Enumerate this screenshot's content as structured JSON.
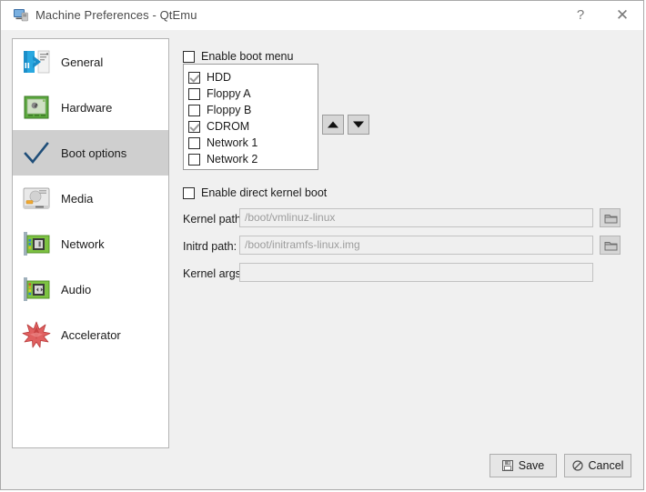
{
  "window": {
    "title": "Machine Preferences - QtEmu",
    "icon": "computer-icon",
    "help_label": "?",
    "close_label": "✕",
    "background": "#f0f0f0"
  },
  "sidebar": {
    "items": [
      {
        "label": "General",
        "icon": "general-icon",
        "selected": false
      },
      {
        "label": "Hardware",
        "icon": "hardware-icon",
        "selected": false
      },
      {
        "label": "Boot options",
        "icon": "boot-options-icon",
        "selected": true
      },
      {
        "label": "Media",
        "icon": "media-icon",
        "selected": false
      },
      {
        "label": "Network",
        "icon": "network-icon",
        "selected": false
      },
      {
        "label": "Audio",
        "icon": "audio-icon",
        "selected": false
      },
      {
        "label": "Accelerator",
        "icon": "accelerator-icon",
        "selected": false
      }
    ],
    "selected_background": "#cfcfcf"
  },
  "boot": {
    "enable_boot_menu_label": "Enable boot menu",
    "enable_boot_menu_checked": false,
    "devices": [
      {
        "label": "HDD",
        "checked": true
      },
      {
        "label": "Floppy A",
        "checked": false
      },
      {
        "label": "Floppy B",
        "checked": false
      },
      {
        "label": "CDROM",
        "checked": true
      },
      {
        "label": "Network 1",
        "checked": false
      },
      {
        "label": "Network 2",
        "checked": false
      }
    ],
    "move_up_icon": "arrow-up-icon",
    "move_down_icon": "arrow-down-icon"
  },
  "kernel": {
    "enable_direct_kernel_boot_label": "Enable direct kernel boot",
    "enable_direct_kernel_boot_checked": false,
    "fields": [
      {
        "label": "Kernel path:",
        "value": "",
        "placeholder": "/boot/vmlinuz-linux",
        "browse": true
      },
      {
        "label": "Initrd path:",
        "value": "",
        "placeholder": "/boot/initramfs-linux.img",
        "browse": true
      },
      {
        "label": "Kernel args:",
        "value": "",
        "placeholder": "",
        "browse": false
      }
    ],
    "browse_icon": "folder-icon"
  },
  "footer": {
    "save_label": "Save",
    "save_icon": "floppy-save-icon",
    "cancel_label": "Cancel",
    "cancel_icon": "cancel-circle-icon"
  }
}
